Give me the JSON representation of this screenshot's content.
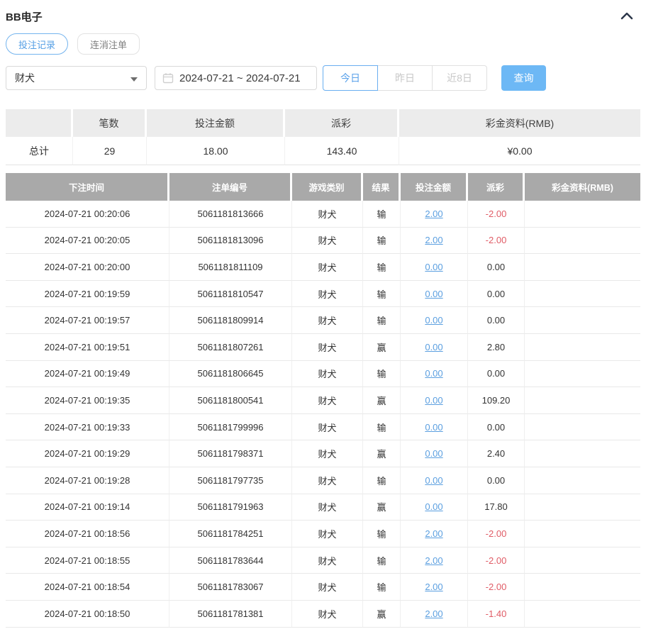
{
  "header": {
    "title": "BB电子",
    "collapse_icon": "chevron-up-icon"
  },
  "tabs": [
    {
      "label": "投注记录",
      "active": true
    },
    {
      "label": "连消注单",
      "active": false
    }
  ],
  "filters": {
    "game_select": {
      "value": "财犬",
      "icon": "chevron-down-caret"
    },
    "date_range": {
      "value": "2024-07-21 ~ 2024-07-21",
      "icon": "calendar-icon"
    },
    "quick_buttons": [
      {
        "label": "今日",
        "active": true
      },
      {
        "label": "昨日",
        "active": false
      },
      {
        "label": "近8日",
        "active": false
      }
    ],
    "query_label": "查询"
  },
  "colors": {
    "accent_blue": "#6db8f5",
    "link_blue": "#5b9fe0",
    "loss_red": "#e05c66",
    "table_header_gray": "#a9a9a9"
  },
  "summary": {
    "headers": [
      "",
      "笔数",
      "投注金额",
      "派彩",
      "彩金资料(RMB)"
    ],
    "row_label": "总计",
    "values": {
      "count": "29",
      "bet_amount": "18.00",
      "payout": "143.40",
      "bonus": "¥0.00"
    }
  },
  "table": {
    "headers": [
      "下注时间",
      "注单编号",
      "游戏类别",
      "结果",
      "投注金额",
      "派彩",
      "彩金资料(RMB)"
    ],
    "rows": [
      {
        "time": "2024-07-21 00:20:06",
        "bet_no": "5061181813666",
        "game": "财犬",
        "result": "输",
        "amount": "2.00",
        "payout": "-2.00",
        "bonus": ""
      },
      {
        "time": "2024-07-21 00:20:05",
        "bet_no": "5061181813096",
        "game": "财犬",
        "result": "输",
        "amount": "2.00",
        "payout": "-2.00",
        "bonus": ""
      },
      {
        "time": "2024-07-21 00:20:00",
        "bet_no": "5061181811109",
        "game": "财犬",
        "result": "输",
        "amount": "0.00",
        "payout": "0.00",
        "bonus": ""
      },
      {
        "time": "2024-07-21 00:19:59",
        "bet_no": "5061181810547",
        "game": "财犬",
        "result": "输",
        "amount": "0.00",
        "payout": "0.00",
        "bonus": ""
      },
      {
        "time": "2024-07-21 00:19:57",
        "bet_no": "5061181809914",
        "game": "财犬",
        "result": "输",
        "amount": "0.00",
        "payout": "0.00",
        "bonus": ""
      },
      {
        "time": "2024-07-21 00:19:51",
        "bet_no": "5061181807261",
        "game": "财犬",
        "result": "赢",
        "amount": "0.00",
        "payout": "2.80",
        "bonus": ""
      },
      {
        "time": "2024-07-21 00:19:49",
        "bet_no": "5061181806645",
        "game": "财犬",
        "result": "输",
        "amount": "0.00",
        "payout": "0.00",
        "bonus": ""
      },
      {
        "time": "2024-07-21 00:19:35",
        "bet_no": "5061181800541",
        "game": "财犬",
        "result": "赢",
        "amount": "0.00",
        "payout": "109.20",
        "bonus": ""
      },
      {
        "time": "2024-07-21 00:19:33",
        "bet_no": "5061181799996",
        "game": "财犬",
        "result": "输",
        "amount": "0.00",
        "payout": "0.00",
        "bonus": ""
      },
      {
        "time": "2024-07-21 00:19:29",
        "bet_no": "5061181798371",
        "game": "财犬",
        "result": "赢",
        "amount": "0.00",
        "payout": "2.40",
        "bonus": ""
      },
      {
        "time": "2024-07-21 00:19:28",
        "bet_no": "5061181797735",
        "game": "财犬",
        "result": "输",
        "amount": "0.00",
        "payout": "0.00",
        "bonus": ""
      },
      {
        "time": "2024-07-21 00:19:14",
        "bet_no": "5061181791963",
        "game": "财犬",
        "result": "赢",
        "amount": "0.00",
        "payout": "17.80",
        "bonus": ""
      },
      {
        "time": "2024-07-21 00:18:56",
        "bet_no": "5061181784251",
        "game": "财犬",
        "result": "输",
        "amount": "2.00",
        "payout": "-2.00",
        "bonus": ""
      },
      {
        "time": "2024-07-21 00:18:55",
        "bet_no": "5061181783644",
        "game": "财犬",
        "result": "输",
        "amount": "2.00",
        "payout": "-2.00",
        "bonus": ""
      },
      {
        "time": "2024-07-21 00:18:54",
        "bet_no": "5061181783067",
        "game": "财犬",
        "result": "输",
        "amount": "2.00",
        "payout": "-2.00",
        "bonus": ""
      },
      {
        "time": "2024-07-21 00:18:50",
        "bet_no": "5061181781381",
        "game": "财犬",
        "result": "赢",
        "amount": "2.00",
        "payout": "-1.40",
        "bonus": ""
      }
    ]
  }
}
